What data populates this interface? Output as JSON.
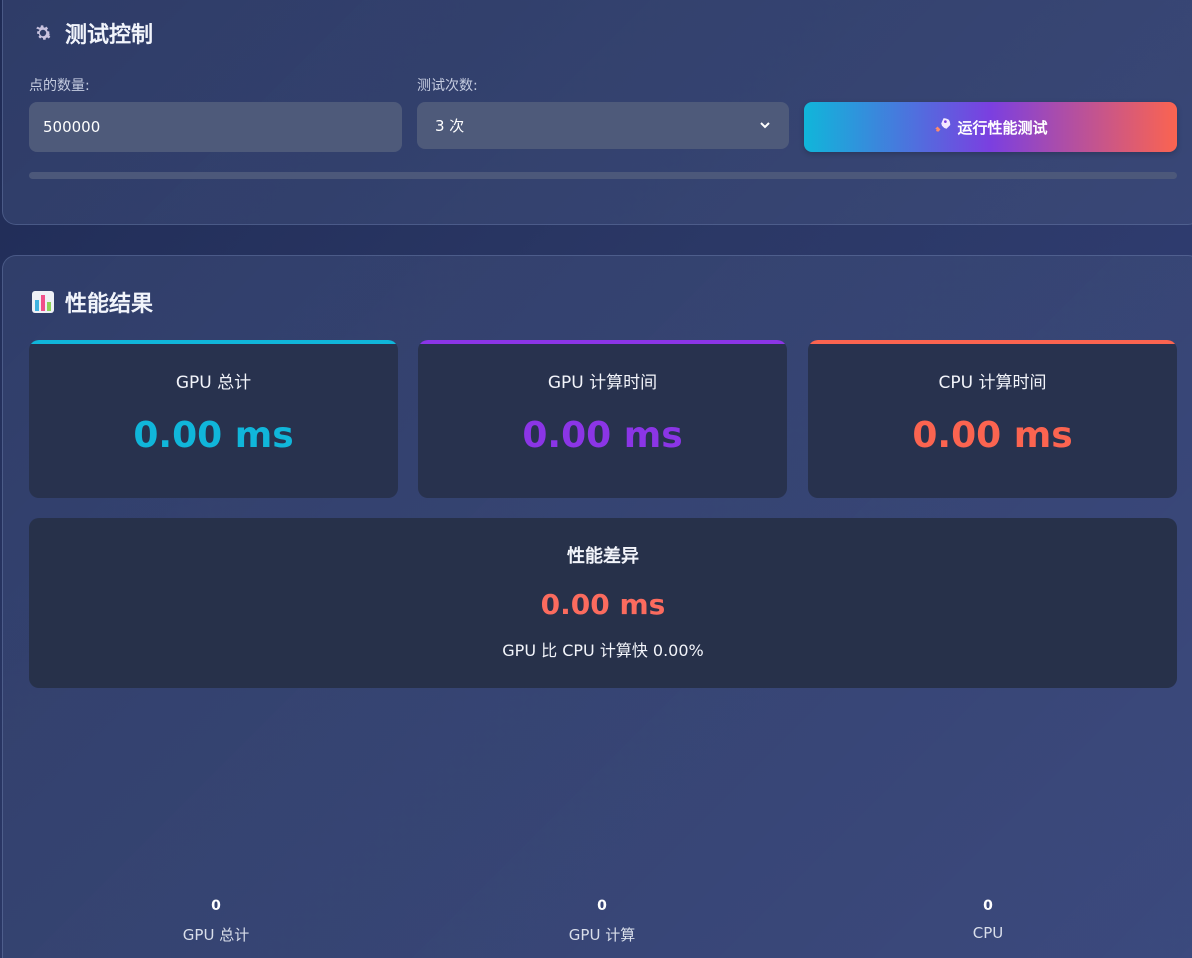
{
  "control": {
    "title": "测试控制",
    "points_label": "点的数量:",
    "points_value": "500000",
    "runs_label": "测试次数:",
    "runs_selected": "3 次",
    "run_button_label": "运行性能测试",
    "progress": 0
  },
  "results": {
    "title": "性能结果",
    "cards": [
      {
        "title": "GPU 总计",
        "value": "0.00 ms",
        "color": "#10b6da"
      },
      {
        "title": "GPU 计算时间",
        "value": "0.00 ms",
        "color": "#8b35e6"
      },
      {
        "title": "CPU 计算时间",
        "value": "0.00 ms",
        "color": "#fb6450"
      }
    ],
    "diff": {
      "title": "性能差异",
      "value": "0.00 ms",
      "description": "GPU 比 CPU 计算快 0.00%"
    },
    "chart_data": {
      "type": "bar",
      "categories": [
        "GPU 总计",
        "GPU 计算",
        "CPU"
      ],
      "values": [
        0,
        0,
        0
      ],
      "value_labels": [
        "0",
        "0",
        "0"
      ]
    }
  }
}
